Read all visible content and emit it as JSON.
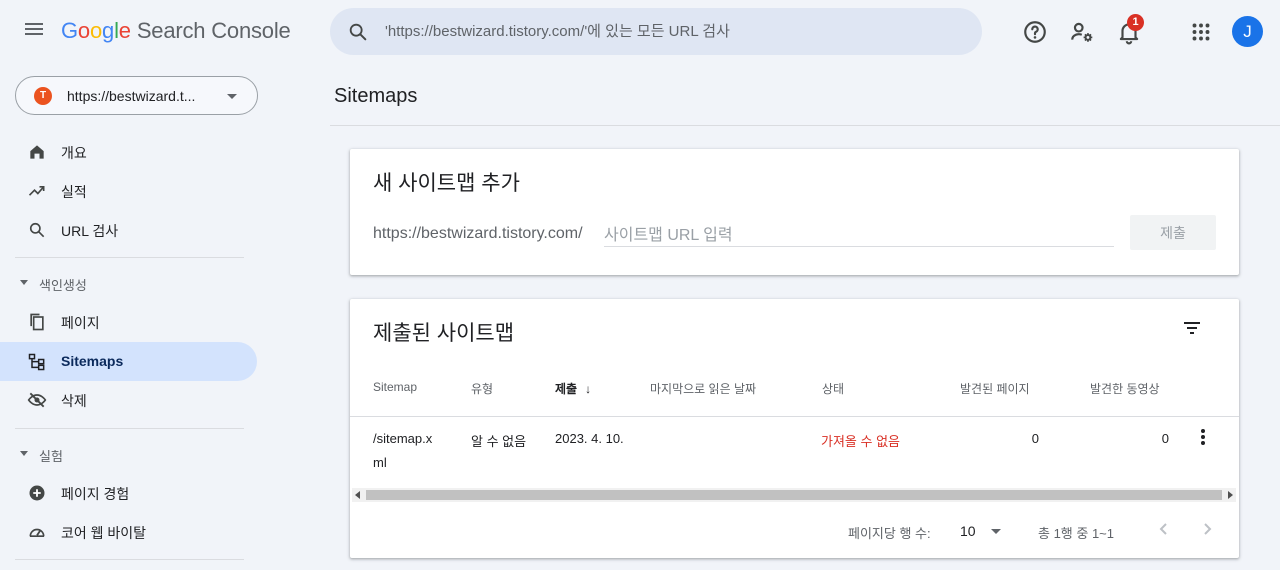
{
  "header": {
    "logo_letters": [
      "G",
      "o",
      "o",
      "g",
      "l",
      "e"
    ],
    "product": "Search Console",
    "search_placeholder": "'https://bestwizard.tistory.com/'에 있는 모든 URL 검사",
    "notification_count": "1",
    "avatar_initial": "J"
  },
  "sidebar": {
    "property": "https://bestwizard.t...",
    "property_favicon": "T",
    "items": [
      {
        "label": "개요",
        "icon": "home-icon"
      },
      {
        "label": "실적",
        "icon": "trending-up-icon"
      },
      {
        "label": "URL 검사",
        "icon": "search-icon"
      }
    ],
    "indexing_header": "색인생성",
    "indexing_items": [
      {
        "label": "페이지",
        "icon": "pages-icon"
      },
      {
        "label": "Sitemaps",
        "icon": "sitemap-icon"
      },
      {
        "label": "삭제",
        "icon": "visibility-off-icon"
      }
    ],
    "experience_header": "실험",
    "experience_items": [
      {
        "label": "페이지 경험",
        "icon": "add-circle-icon"
      },
      {
        "label": "코어 웹 바이탈",
        "icon": "speed-icon"
      }
    ]
  },
  "main": {
    "title": "Sitemaps",
    "add_card": {
      "title": "새 사이트맵 추가",
      "prefix": "https://bestwizard.tistory.com/",
      "input_placeholder": "사이트맵 URL 입력",
      "submit_label": "제출"
    },
    "submitted_card": {
      "title": "제출된 사이트맵",
      "columns": [
        "Sitemap",
        "유형",
        "제출",
        "마지막으로 읽은 날짜",
        "상태",
        "발견된 페이지",
        "발견한 동영상"
      ],
      "sort_arrow": "↓",
      "rows": [
        {
          "sitemap_line1": "/sitemap.x",
          "sitemap_line2": "ml",
          "type": "알 수 없음",
          "submitted": "2023. 4. 10.",
          "last_read": "",
          "status": "가져올 수 없음",
          "pages": "0",
          "videos": "0"
        }
      ],
      "pager": {
        "rows_per_page_label": "페이지당 행 수:",
        "rows_per_page_value": "10",
        "range_text": "총 1행 중 1~1"
      }
    }
  },
  "colors": {
    "accent": "#1a73e8",
    "active_nav": "#d3e3fd",
    "error": "#d93025",
    "badge": "#d93025"
  }
}
